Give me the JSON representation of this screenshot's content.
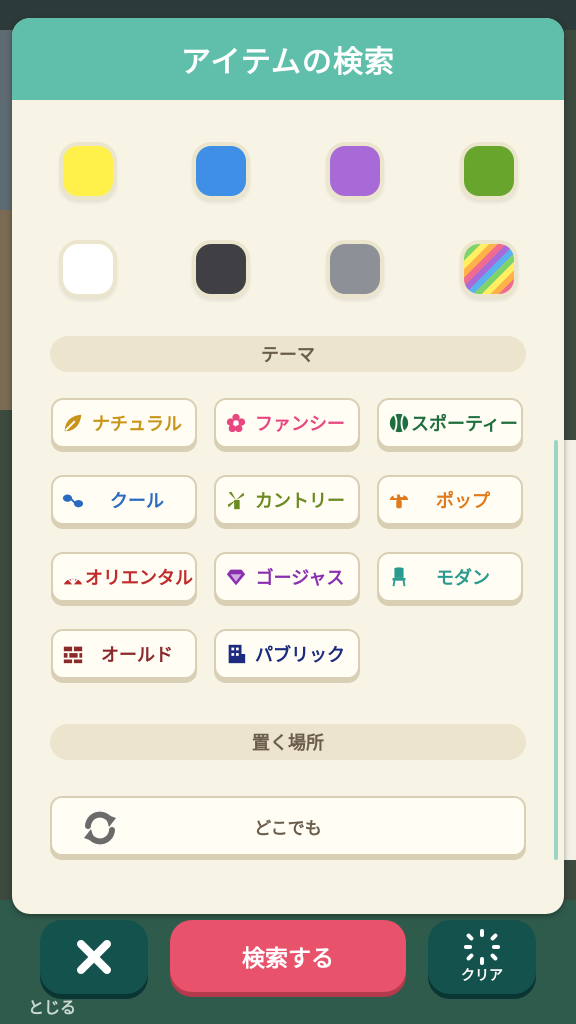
{
  "title": "アイテムの検索",
  "colors": [
    {
      "name": "yellow",
      "hex": "#fff14a"
    },
    {
      "name": "blue",
      "hex": "#3f8fe6"
    },
    {
      "name": "purple",
      "hex": "#a86ad6"
    },
    {
      "name": "green",
      "hex": "#68a52c"
    },
    {
      "name": "white",
      "hex": "#ffffff"
    },
    {
      "name": "black",
      "hex": "#3f3f44"
    },
    {
      "name": "gray",
      "hex": "#8d9197"
    },
    {
      "name": "rainbow",
      "hex": "multi"
    }
  ],
  "theme_section": "テーマ",
  "themes": [
    {
      "label": "ナチュラル",
      "color": "#c8941a",
      "icon": "leaf-icon"
    },
    {
      "label": "ファンシー",
      "color": "#e8467f",
      "icon": "flower-icon"
    },
    {
      "label": "スポーティー",
      "color": "#1f6e3d",
      "icon": "ball-icon"
    },
    {
      "label": "クール",
      "color": "#2a6bbf",
      "icon": "sunglasses-icon"
    },
    {
      "label": "カントリー",
      "color": "#6b8a1f",
      "icon": "windmill-icon"
    },
    {
      "label": "ポップ",
      "color": "#e07a1a",
      "icon": "mushroom-icon"
    },
    {
      "label": "オリエンタル",
      "color": "#c02a2a",
      "icon": "fan-icon"
    },
    {
      "label": "ゴージャス",
      "color": "#8a2fb0",
      "icon": "gem-icon"
    },
    {
      "label": "モダン",
      "color": "#2a9a8e",
      "icon": "chair-icon"
    },
    {
      "label": "オールド",
      "color": "#8a2a2a",
      "icon": "brick-icon"
    },
    {
      "label": "パブリック",
      "color": "#1c2a80",
      "icon": "building-icon"
    }
  ],
  "place_section": "置く場所",
  "place_option": "どこでも",
  "footer": {
    "search_label": "検索する",
    "clear_label": "クリア"
  },
  "background_text": "とじる"
}
